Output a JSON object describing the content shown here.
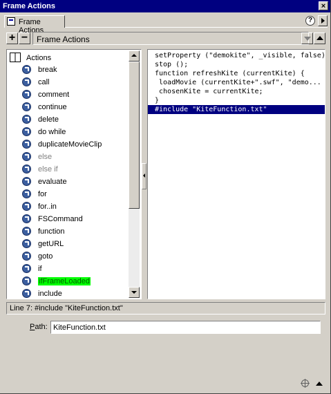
{
  "window": {
    "title": "Frame Actions"
  },
  "tab": {
    "label": "Frame Actions"
  },
  "toolbar": {
    "add": "+",
    "remove": "−",
    "panel_title": "Frame Actions"
  },
  "tree": {
    "header": "Actions",
    "items": [
      {
        "label": "break",
        "state": "normal"
      },
      {
        "label": "call",
        "state": "normal"
      },
      {
        "label": "comment",
        "state": "normal"
      },
      {
        "label": "continue",
        "state": "normal"
      },
      {
        "label": "delete",
        "state": "normal"
      },
      {
        "label": "do while",
        "state": "normal"
      },
      {
        "label": "duplicateMovieClip",
        "state": "normal"
      },
      {
        "label": "else",
        "state": "dim"
      },
      {
        "label": "else if",
        "state": "dim"
      },
      {
        "label": "evaluate",
        "state": "normal"
      },
      {
        "label": "for",
        "state": "normal"
      },
      {
        "label": "for..in",
        "state": "normal"
      },
      {
        "label": "FSCommand",
        "state": "normal"
      },
      {
        "label": "function",
        "state": "normal"
      },
      {
        "label": "getURL",
        "state": "normal"
      },
      {
        "label": "goto",
        "state": "normal"
      },
      {
        "label": "if",
        "state": "normal"
      },
      {
        "label": "ifFrameLoaded",
        "state": "highlight"
      },
      {
        "label": "include",
        "state": "normal"
      }
    ]
  },
  "code": {
    "lines": [
      {
        "text": "setProperty (\"demokite\", _visible, false);",
        "selected": false
      },
      {
        "text": "stop ();",
        "selected": false
      },
      {
        "text": "function refreshKite (currentKite) {",
        "selected": false
      },
      {
        "text": " loadMovie (currentKite+\".swf\", \"demo...",
        "selected": false
      },
      {
        "text": " chosenKite = currentKite;",
        "selected": false
      },
      {
        "text": "}",
        "selected": false
      },
      {
        "text": "#include \"KiteFunction.txt\"",
        "selected": true
      }
    ]
  },
  "status": {
    "text": "Line 7: #include \"KiteFunction.txt\""
  },
  "path": {
    "label_accel": "P",
    "label_rest": "ath:",
    "value": "KiteFunction.txt"
  },
  "colors": {
    "titlebar": "#000080",
    "selection": "#000080",
    "highlight": "#00ff00"
  },
  "icons": [
    "close-icon",
    "help-icon",
    "menu-arrow-icon",
    "actions-book-icon",
    "action-arrow-icon",
    "target-icon",
    "collapse-icon"
  ]
}
